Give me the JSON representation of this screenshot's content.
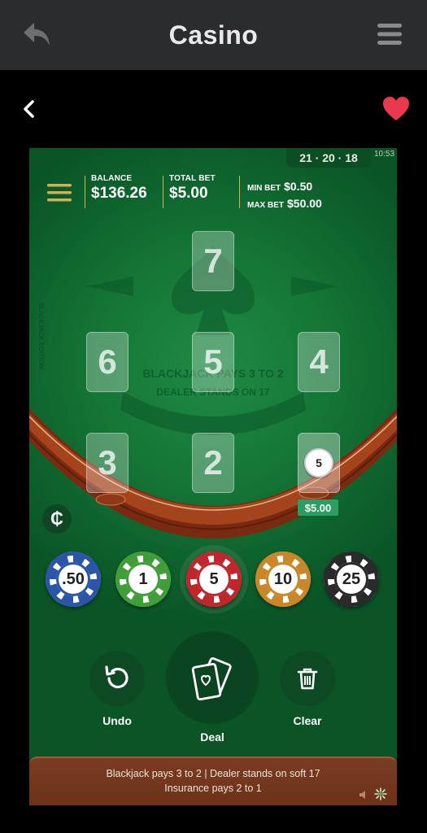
{
  "header": {
    "title": "Casino"
  },
  "game": {
    "status": "21 · 20 · 18",
    "time": "10:53",
    "balance_label": "BALANCE",
    "balance_value": "$136.26",
    "totalbet_label": "TOTAL BET",
    "totalbet_value": "$5.00",
    "minbet_label": "MIN BET",
    "minbet_value": "$0.50",
    "maxbet_label": "MAX BET",
    "maxbet_value": "$50.00",
    "seats": [
      "7",
      "6",
      "5",
      "4",
      "3",
      "2"
    ],
    "active_seat_chip": "5",
    "active_seat_amount": "$5.00",
    "swap_symbol": "₵",
    "chips": [
      {
        "label": ".50",
        "color": "#2a55a8"
      },
      {
        "label": "1",
        "color": "#3f9d3a"
      },
      {
        "label": "5",
        "color": "#c0262b"
      },
      {
        "label": "10",
        "color": "#c9872a"
      },
      {
        "label": "25",
        "color": "#2a2a2a"
      }
    ],
    "selected_chip": "5",
    "undo_label": "Undo",
    "deal_label": "Deal",
    "clear_label": "Clear",
    "rule_line1": "Blackjack pays 3 to 2  |  Dealer stands on soft 17",
    "rule_line2": "Insurance pays 2 to 1"
  }
}
